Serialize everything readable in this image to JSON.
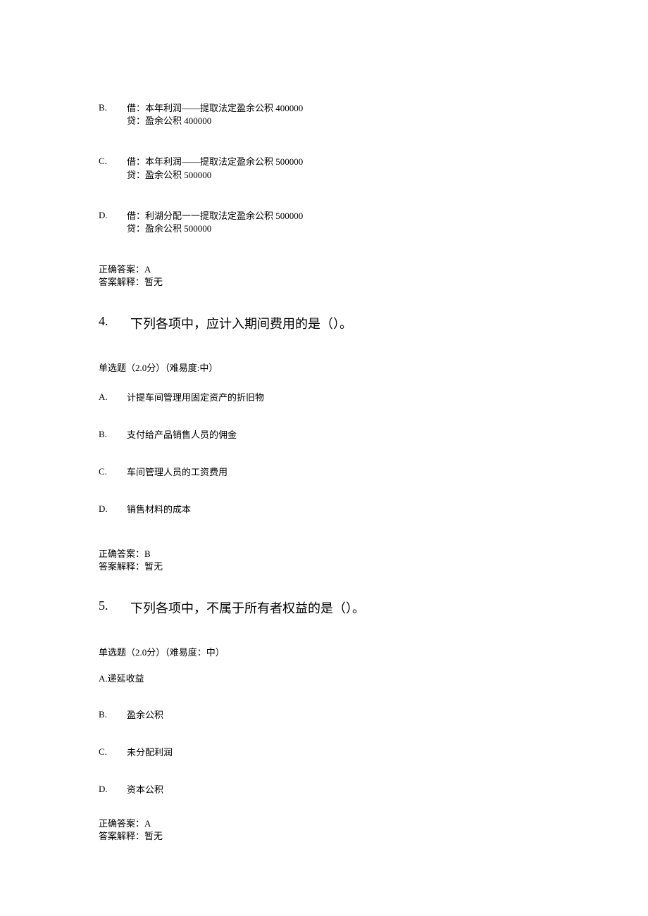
{
  "q3_options": {
    "b": {
      "label": "B.",
      "line1": "借：本年利润——提取法定盈余公积 400000",
      "line2": "贷：盈余公积 400000"
    },
    "c": {
      "label": "C.",
      "line1": "借：本年利润——提取法定盈余公积 500000",
      "line2": "贷：盈余公积 500000"
    },
    "d": {
      "label": "D.",
      "line1": "借：利湖分配一一提取法定盈余公积 500000",
      "line2": "贷：盈余公积 500000"
    }
  },
  "q3_answer": {
    "correct": "正确答案：A",
    "explain": "答案解释：暂无"
  },
  "q4": {
    "number": "4.",
    "text": "下列各项中，应计入期间费用的是（）。",
    "meta": "单选题（2.0分）（难易度:中）",
    "options": {
      "a": {
        "label": "A.",
        "text": "计提车间管理用固定资产的折旧物"
      },
      "b": {
        "label": "B.",
        "text": "支付给产品销售人员的佣金"
      },
      "c": {
        "label": "C.",
        "text": "车间管理人员的工资费用"
      },
      "d": {
        "label": "D.",
        "text": "销售材料的成本"
      }
    },
    "answer": {
      "correct": "正确答案：B",
      "explain": "答案解释：暂无"
    }
  },
  "q5": {
    "number": "5.",
    "text": "下列各项中，不属于所有者权益的是（）。",
    "meta": "单选题（2.0分）（难易度：中）",
    "options": {
      "a": {
        "text": "A.递延收益"
      },
      "b": {
        "label": "B.",
        "text": "盈余公积"
      },
      "c": {
        "label": "C.",
        "text": "未分配利润"
      },
      "d": {
        "label": "D.",
        "text": "资本公积"
      }
    },
    "answer": {
      "correct": "正确答案：A",
      "explain": "答案解释：暂无"
    }
  }
}
